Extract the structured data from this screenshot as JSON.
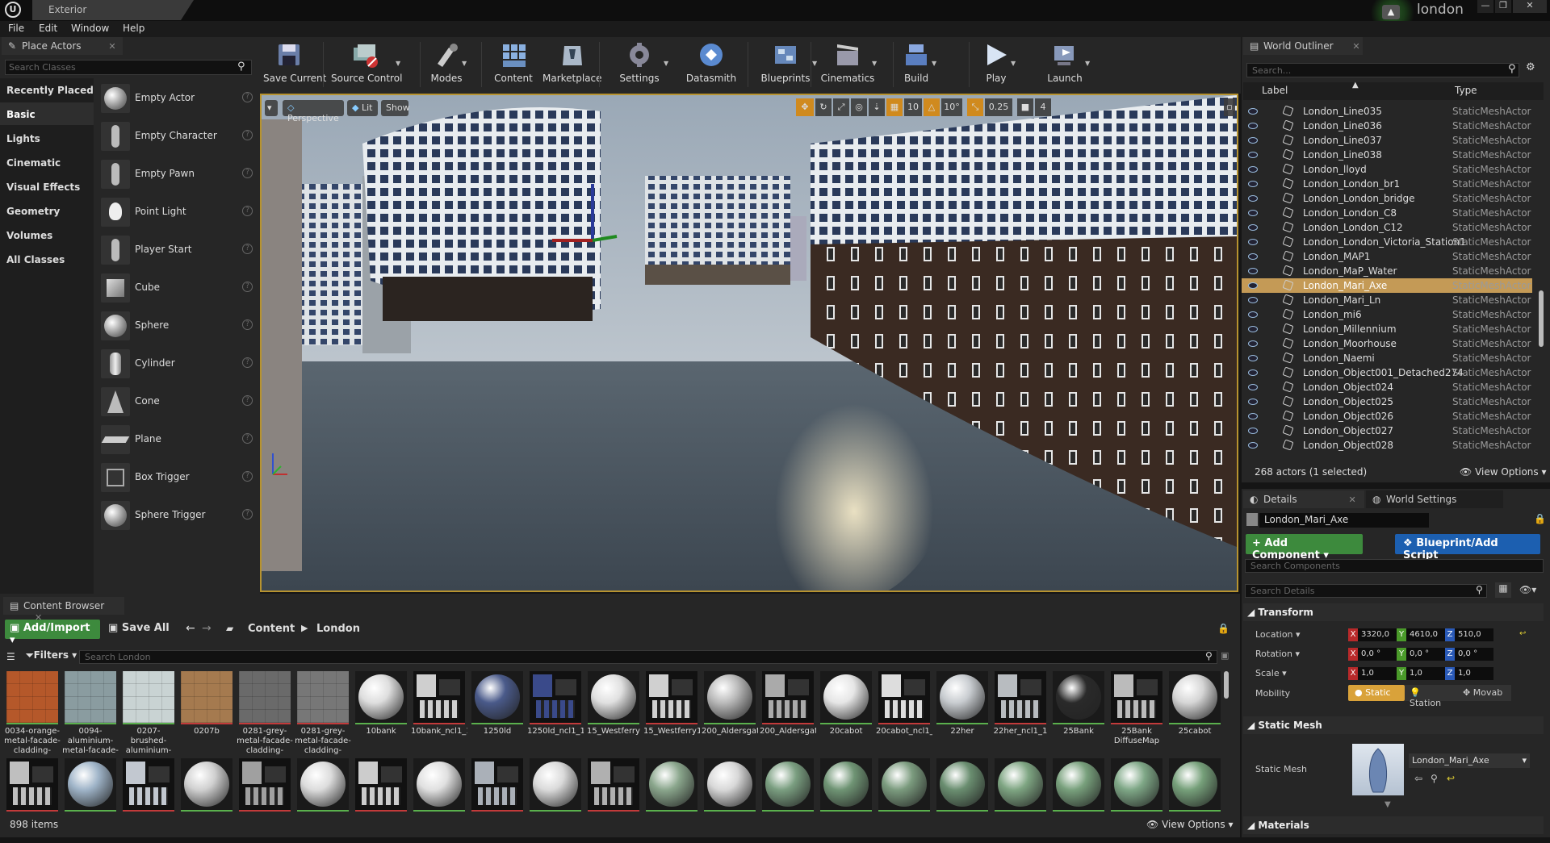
{
  "app": {
    "tab_title": "Exterior",
    "project_name": "london",
    "window_controls": [
      "—",
      "❐",
      "✕"
    ]
  },
  "menu": [
    "File",
    "Edit",
    "Window",
    "Help"
  ],
  "place_actors": {
    "tab": "Place Actors",
    "search_placeholder": "Search Classes",
    "categories": [
      "Recently Placed",
      "Basic",
      "Lights",
      "Cinematic",
      "Visual Effects",
      "Geometry",
      "Volumes",
      "All Classes"
    ],
    "selected_category": "Basic",
    "items": [
      "Empty Actor",
      "Empty Character",
      "Empty Pawn",
      "Point Light",
      "Player Start",
      "Cube",
      "Sphere",
      "Cylinder",
      "Cone",
      "Plane",
      "Box Trigger",
      "Sphere Trigger"
    ]
  },
  "toolbar": [
    {
      "label": "Save Current",
      "icon": "save-icon"
    },
    {
      "label": "Source Control",
      "icon": "source-control-icon"
    },
    {
      "label": "Modes",
      "icon": "modes-icon"
    },
    {
      "label": "Content",
      "icon": "content-icon"
    },
    {
      "label": "Marketplace",
      "icon": "marketplace-icon"
    },
    {
      "label": "Settings",
      "icon": "settings-icon"
    },
    {
      "label": "Datasmith",
      "icon": "datasmith-icon"
    },
    {
      "label": "Blueprints",
      "icon": "blueprints-icon"
    },
    {
      "label": "Cinematics",
      "icon": "cinematics-icon"
    },
    {
      "label": "Build",
      "icon": "build-icon"
    },
    {
      "label": "Play",
      "icon": "play-icon"
    },
    {
      "label": "Launch",
      "icon": "launch-icon"
    }
  ],
  "viewport": {
    "view_mode": "Perspective",
    "lit": "Lit",
    "show": "Show",
    "grid_snap": "10",
    "rotation_snap": "10°",
    "scale_snap": "0.25",
    "camera_speed": "4"
  },
  "outliner": {
    "tab": "World Outliner",
    "search_placeholder": "Search...",
    "col_label": "Label",
    "col_type": "Type",
    "rows": [
      {
        "name": "London_Line035",
        "type": "StaticMeshActor"
      },
      {
        "name": "London_Line036",
        "type": "StaticMeshActor"
      },
      {
        "name": "London_Line037",
        "type": "StaticMeshActor"
      },
      {
        "name": "London_Line038",
        "type": "StaticMeshActor"
      },
      {
        "name": "London_lloyd",
        "type": "StaticMeshActor"
      },
      {
        "name": "London_London_br1",
        "type": "StaticMeshActor"
      },
      {
        "name": "London_London_bridge",
        "type": "StaticMeshActor"
      },
      {
        "name": "London_London_C8",
        "type": "StaticMeshActor"
      },
      {
        "name": "London_London_C12",
        "type": "StaticMeshActor"
      },
      {
        "name": "London_London_Victoria_Station1",
        "type": "StaticMeshActor"
      },
      {
        "name": "London_MAP1",
        "type": "StaticMeshActor"
      },
      {
        "name": "London_MaP_Water",
        "type": "StaticMeshActor"
      },
      {
        "name": "London_Mari_Axe",
        "type": "StaticMeshActor"
      },
      {
        "name": "London_Mari_Ln",
        "type": "StaticMeshActor"
      },
      {
        "name": "London_mi6",
        "type": "StaticMeshActor"
      },
      {
        "name": "London_Millennium",
        "type": "StaticMeshActor"
      },
      {
        "name": "London_Moorhouse",
        "type": "StaticMeshActor"
      },
      {
        "name": "London_Naemi",
        "type": "StaticMeshActor"
      },
      {
        "name": "London_Object001_Detached274",
        "type": "StaticMeshActor"
      },
      {
        "name": "London_Object024",
        "type": "StaticMeshActor"
      },
      {
        "name": "London_Object025",
        "type": "StaticMeshActor"
      },
      {
        "name": "London_Object026",
        "type": "StaticMeshActor"
      },
      {
        "name": "London_Object027",
        "type": "StaticMeshActor"
      },
      {
        "name": "London_Object028",
        "type": "StaticMeshActor"
      }
    ],
    "selected": "London_Mari_Axe",
    "status": "268 actors (1 selected)",
    "view_options": "View Options"
  },
  "details": {
    "tabs": [
      "Details",
      "World Settings"
    ],
    "object_name": "London_Mari_Axe",
    "add_component": "Add Component",
    "blueprint": "Blueprint/Add Script",
    "search_components": "Search Components",
    "search_details": "Search Details",
    "transform": {
      "header": "Transform",
      "location": {
        "label": "Location",
        "x": "3320,0",
        "y": "4610,0",
        "z": "510,0"
      },
      "rotation": {
        "label": "Rotation",
        "x": "0,0 °",
        "y": "0,0 °",
        "z": "0,0 °"
      },
      "scale": {
        "label": "Scale",
        "x": "1,0",
        "y": "1,0",
        "z": "1,0"
      },
      "mobility": {
        "label": "Mobility",
        "options": [
          "Static",
          "Station",
          "Movab"
        ],
        "selected": "Static"
      }
    },
    "static_mesh": {
      "header": "Static Mesh",
      "label": "Static Mesh",
      "value": "London_Mari_Axe"
    },
    "materials_header": "Materials"
  },
  "content_browser": {
    "tab": "Content Browser",
    "add_import": "Add/Import",
    "save_all": "Save All",
    "path": [
      "Content",
      "London"
    ],
    "filters": "Filters",
    "search_placeholder": "Search London",
    "row1": [
      {
        "label": "0034-orange-metal-facade-cladding-",
        "color": "#b5582a",
        "bar": "#5ab04d",
        "style": "tile"
      },
      {
        "label": "0094-aluminium-metal-facade-",
        "color": "#8a9ca0",
        "bar": "#5ab04d",
        "style": "tile"
      },
      {
        "label": "0207-brushed-aluminium-facade-",
        "color": "#c9d3d3",
        "bar": "#5ab04d",
        "style": "tile"
      },
      {
        "label": "0207b",
        "color": "#a57a4f",
        "bar": "#c23a3a",
        "style": "tile"
      },
      {
        "label": "0281-grey-metal-facade-cladding-",
        "color": "#6a6a6a",
        "bar": "#c23a3a",
        "style": "tile"
      },
      {
        "label": "0281-grey-metal-facade-cladding-",
        "color": "#777777",
        "bar": "#c23a3a",
        "style": "tile"
      },
      {
        "label": "10bank",
        "color": "#dedede",
        "bar": "#5ab04d",
        "style": "sphere"
      },
      {
        "label": "10bank_ncl1_1",
        "color": "#cfcfcf",
        "bar": "#c23a3a",
        "style": "tex"
      },
      {
        "label": "1250ld",
        "color": "#4a5a8a",
        "bar": "#5ab04d",
        "style": "sphere"
      },
      {
        "label": "1250ld_ncl1_1",
        "color": "#3a4a8a",
        "bar": "#c23a3a",
        "style": "tex"
      },
      {
        "label": "15_Westferry",
        "color": "#e0e0e0",
        "bar": "#5ab04d",
        "style": "sphere"
      },
      {
        "label": "15_Westferry1",
        "color": "#d0d0d0",
        "bar": "#c23a3a",
        "style": "tex"
      },
      {
        "label": "200_Aldersgate",
        "color": "#bababa",
        "bar": "#5ab04d",
        "style": "sphere"
      },
      {
        "label": "200_Aldersgate1",
        "color": "#aaaaaa",
        "bar": "#c23a3a",
        "style": "tex"
      },
      {
        "label": "20cabot",
        "color": "#e6e6e6",
        "bar": "#5ab04d",
        "style": "sphere"
      },
      {
        "label": "20cabot_ncl1_1",
        "color": "#dddddd",
        "bar": "#c23a3a",
        "style": "tex"
      },
      {
        "label": "22her",
        "color": "#c8ccd0",
        "bar": "#5ab04d",
        "style": "sphere"
      },
      {
        "label": "22her_ncl1_1",
        "color": "#b8bcc0",
        "bar": "#c23a3a",
        "style": "tex"
      },
      {
        "label": "25Bank",
        "color": "#2a2a2a",
        "bar": "#5ab04d",
        "style": "sphere"
      },
      {
        "label": "25Bank DiffuseMap",
        "color": "#bbbbbb",
        "bar": "#c23a3a",
        "style": "tex"
      },
      {
        "label": "25cabot",
        "color": "#d6d6d6",
        "bar": "#5ab04d",
        "style": "sphere"
      }
    ],
    "row2": [
      {
        "color": "#bfbfbf",
        "style": "tex"
      },
      {
        "color": "#9fb4c8",
        "style": "sphere"
      },
      {
        "color": "#c2c8d0",
        "style": "tex"
      },
      {
        "color": "#d0d0d0",
        "style": "sphere"
      },
      {
        "color": "#a0a0a0",
        "style": "tex"
      },
      {
        "color": "#dcdcdc",
        "style": "sphere"
      },
      {
        "color": "#cccccc",
        "style": "tex"
      },
      {
        "color": "#e0e0e0",
        "style": "sphere"
      },
      {
        "color": "#aab0b8",
        "style": "tex"
      },
      {
        "color": "#dadada",
        "style": "sphere"
      },
      {
        "color": "#b0b0b0",
        "style": "tex"
      },
      {
        "color": "#8aa68c",
        "style": "sphere"
      },
      {
        "color": "#d8d8d8",
        "style": "sphere"
      },
      {
        "color": "#7a9e80",
        "style": "sphere"
      },
      {
        "color": "#6f9474",
        "style": "sphere"
      },
      {
        "color": "#7b9b7e",
        "style": "sphere"
      },
      {
        "color": "#6a8e70",
        "style": "sphere"
      },
      {
        "color": "#7ea582",
        "style": "sphere"
      },
      {
        "color": "#78a07c",
        "style": "sphere"
      },
      {
        "color": "#7ea786",
        "style": "sphere"
      },
      {
        "color": "#76a07a",
        "style": "sphere"
      }
    ],
    "item_count": "898 items",
    "view_options": "View Options"
  }
}
